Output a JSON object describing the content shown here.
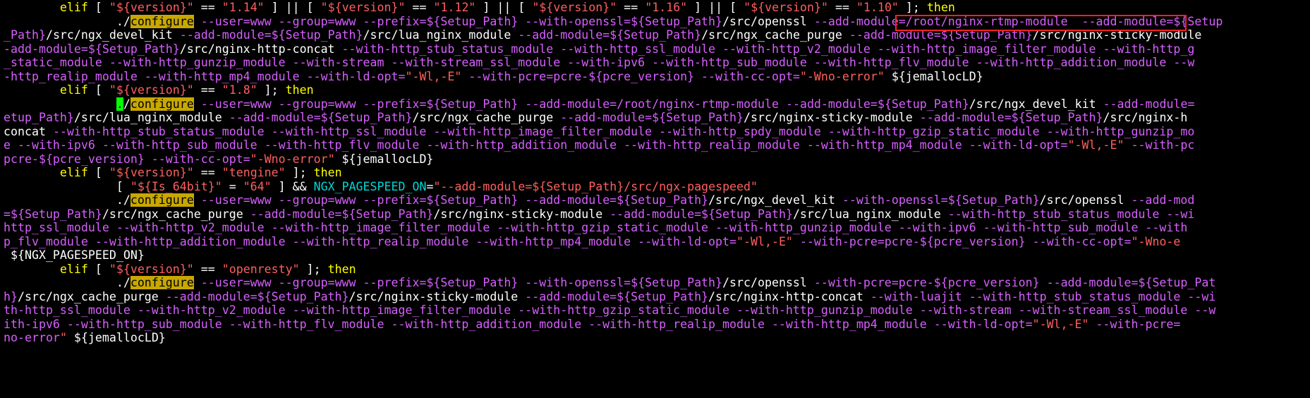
{
  "window": {
    "background": "#000000"
  },
  "colors": {
    "keyword": "#ffff00",
    "string": "#ff5f5f",
    "variable": "#d75fff",
    "text": "#ffffff",
    "shell_var": "#00d7d7",
    "search_highlight_bg": "#c8a800",
    "cursor_bg": "#00ff00",
    "annotation_box": "#ff2020"
  },
  "lines": [
    [
      [
        "kw",
        "        elif"
      ],
      [
        "bw",
        " [ "
      ],
      [
        "str",
        "\"${version}\""
      ],
      [
        "bw",
        " == "
      ],
      [
        "str",
        "\"1.14\""
      ],
      [
        "bw",
        " ] || [ "
      ],
      [
        "str",
        "\"${version}\""
      ],
      [
        "bw",
        " == "
      ],
      [
        "str",
        "\"1.12\""
      ],
      [
        "bw",
        " ] || [ "
      ],
      [
        "str",
        "\"${version}\""
      ],
      [
        "bw",
        " == "
      ],
      [
        "str",
        "\"1.16\""
      ],
      [
        "bw",
        " ] || [ "
      ],
      [
        "str",
        "\"${version}\""
      ],
      [
        "bw",
        " == "
      ],
      [
        "str",
        "\"1.10\""
      ],
      [
        "bw",
        " ]; "
      ],
      [
        "kw",
        "then"
      ]
    ],
    [
      [
        "bw",
        "                ./"
      ],
      [
        "hl",
        "configure"
      ],
      [
        "bw",
        " "
      ],
      [
        "var",
        "--user=www --group=www --prefix=${Setup_Path} --with-openssl=${Setup_Path}"
      ],
      [
        "bw",
        "/src/openssl "
      ],
      [
        "var",
        "--add-module=/root/nginx-rtmp-module"
      ],
      [
        "bw",
        "  "
      ],
      [
        "var",
        "--add-module=${Setup"
      ]
    ],
    [
      [
        "var",
        "_Path}"
      ],
      [
        "bw",
        "/src/ngx_devel_kit "
      ],
      [
        "var",
        "--add-module=${Setup_Path}"
      ],
      [
        "bw",
        "/src/lua_nginx_module "
      ],
      [
        "var",
        "--add-module=${Setup_Path}"
      ],
      [
        "bw",
        "/src/ngx_cache_purge "
      ],
      [
        "var",
        "--add-module=${Setup_Path}"
      ],
      [
        "bw",
        "/src/nginx-sticky-module"
      ]
    ],
    [
      [
        "var",
        "-add-module=${Setup_Path}"
      ],
      [
        "bw",
        "/src/nginx-http-concat "
      ],
      [
        "var",
        "--with-http_stub_status_module --with-http_ssl_module --with-http_v2_module --with-http_image_filter_module --with-http_g"
      ]
    ],
    [
      [
        "var",
        "_static_module --with-http_gunzip_module --with-stream --with-stream_ssl_module --with-ipv6 --with-http_sub_module --with-http_flv_module --with-http_addition_module --w"
      ]
    ],
    [
      [
        "var",
        "-http_realip_module --with-http_mp4_module --with-ld-opt="
      ],
      [
        "str",
        "\"-Wl,-E\""
      ],
      [
        "var",
        " --with-pcre=pcre-${pcre_version} --with-cc-opt="
      ],
      [
        "str",
        "\"-Wno-error\""
      ],
      [
        "bw",
        " ${jemallocLD}"
      ]
    ],
    [
      [
        "kw",
        "        elif"
      ],
      [
        "bw",
        " [ "
      ],
      [
        "str",
        "\"${version}\""
      ],
      [
        "bw",
        " == "
      ],
      [
        "str",
        "\"1.8\""
      ],
      [
        "bw",
        " ]; "
      ],
      [
        "kw",
        "then"
      ]
    ],
    [
      [
        "bw",
        "                "
      ],
      [
        "cursor",
        "."
      ],
      [
        "bw",
        "/"
      ],
      [
        "hl",
        "configure"
      ],
      [
        "bw",
        " "
      ],
      [
        "var",
        "--user=www --group=www --prefix=${Setup_Path} --add-module=/root/nginx-rtmp-module --add-module=${Setup_Path}"
      ],
      [
        "bw",
        "/src/ngx_devel_kit "
      ],
      [
        "var",
        "--add-module="
      ]
    ],
    [
      [
        "var",
        "etup_Path}"
      ],
      [
        "bw",
        "/src/lua_nginx_module "
      ],
      [
        "var",
        "--add-module=${Setup_Path}"
      ],
      [
        "bw",
        "/src/ngx_cache_purge "
      ],
      [
        "var",
        "--add-module=${Setup_Path}"
      ],
      [
        "bw",
        "/src/nginx-sticky-module "
      ],
      [
        "var",
        "--add-module=${Setup_Path}"
      ],
      [
        "bw",
        "/src/nginx-h"
      ]
    ],
    [
      [
        "bw",
        "concat "
      ],
      [
        "var",
        "--with-http_stub_status_module --with-http_ssl_module --with-http_image_filter_module --with-http_spdy_module --with-http_gzip_static_module --with-http_gunzip_mo"
      ]
    ],
    [
      [
        "var",
        "e --with-ipv6 --with-http_sub_module --with-http_flv_module --with-http_addition_module --with-http_realip_module --with-http_mp4_module --with-ld-opt="
      ],
      [
        "str",
        "\"-Wl,-E\""
      ],
      [
        "var",
        " --with-pc"
      ]
    ],
    [
      [
        "var",
        "pcre-${pcre_version} --with-cc-opt="
      ],
      [
        "str",
        "\"-Wno-error\""
      ],
      [
        "bw",
        " ${jemallocLD}"
      ]
    ],
    [
      [
        "kw",
        "        elif"
      ],
      [
        "bw",
        " [ "
      ],
      [
        "str",
        "\"${version}\""
      ],
      [
        "bw",
        " == "
      ],
      [
        "str",
        "\"tengine\""
      ],
      [
        "bw",
        " ]; "
      ],
      [
        "kw",
        "then"
      ]
    ],
    [
      [
        "bw",
        "                [ "
      ],
      [
        "str",
        "\"${Is_64bit}\""
      ],
      [
        "bw",
        " = "
      ],
      [
        "str",
        "\"64\""
      ],
      [
        "bw",
        " ] && "
      ],
      [
        "cy",
        "NGX_PAGESPEED_ON"
      ],
      [
        "bw",
        "="
      ],
      [
        "str",
        "\"--add-module=${Setup_Path}/src/ngx-pagespeed\""
      ]
    ],
    [
      [
        "bw",
        "                ./"
      ],
      [
        "hl",
        "configure"
      ],
      [
        "bw",
        " "
      ],
      [
        "var",
        "--user=www --group=www --prefix=${Setup_Path} --add-module=${Setup_Path}"
      ],
      [
        "bw",
        "/src/ngx_devel_kit "
      ],
      [
        "var",
        "--with-openssl=${Setup_Path}"
      ],
      [
        "bw",
        "/src/openssl "
      ],
      [
        "var",
        "--add-mod"
      ]
    ],
    [
      [
        "var",
        "=${Setup_Path}"
      ],
      [
        "bw",
        "/src/ngx_cache_purge "
      ],
      [
        "var",
        "--add-module=${Setup_Path}"
      ],
      [
        "bw",
        "/src/nginx-sticky-module "
      ],
      [
        "var",
        "--add-module=${Setup_Path}"
      ],
      [
        "bw",
        "/src/lua_nginx_module "
      ],
      [
        "var",
        "--with-http_stub_status_module --wi"
      ]
    ],
    [
      [
        "var",
        "http_ssl_module --with-http_v2_module --with-http_image_filter_module --with-http_gzip_static_module --with-http_gunzip_module --with-ipv6 --with-http_sub_module --with"
      ]
    ],
    [
      [
        "var",
        "p_flv_module --with-http_addition_module --with-http_realip_module --with-http_mp4_module --with-ld-opt="
      ],
      [
        "str",
        "\"-Wl,-E\""
      ],
      [
        "var",
        " --with-pcre=pcre-${pcre_version} --with-cc-opt="
      ],
      [
        "str",
        "\"-Wno-e"
      ]
    ],
    [
      [
        "bw",
        " ${NGX_PAGESPEED_ON}"
      ]
    ],
    [
      [
        "kw",
        "        elif"
      ],
      [
        "bw",
        " [ "
      ],
      [
        "str",
        "\"${version}\""
      ],
      [
        "bw",
        " == "
      ],
      [
        "str",
        "\"openresty\""
      ],
      [
        "bw",
        " ]; "
      ],
      [
        "kw",
        "then"
      ]
    ],
    [
      [
        "bw",
        "                ./"
      ],
      [
        "hl",
        "configure"
      ],
      [
        "bw",
        " "
      ],
      [
        "var",
        "--user=www --group=www --prefix=${Setup_Path} --with-openssl=${Setup_Path}"
      ],
      [
        "bw",
        "/src/openssl "
      ],
      [
        "var",
        "--with-pcre=pcre-${pcre_version} --add-module=${Setup_Pat"
      ]
    ],
    [
      [
        "var",
        "h}"
      ],
      [
        "bw",
        "/src/ngx_cache_purge "
      ],
      [
        "var",
        "--add-module=${Setup_Path}"
      ],
      [
        "bw",
        "/src/nginx-sticky-module "
      ],
      [
        "var",
        "--add-module=${Setup_Path}"
      ],
      [
        "bw",
        "/src/nginx-http-concat "
      ],
      [
        "var",
        "--with-luajit --with-http_stub_status_module --wi"
      ]
    ],
    [
      [
        "var",
        "th-http_ssl_module --with-http_v2_module --with-http_image_filter_module --with-http_gzip_static_module --with-http_gunzip_module --with-stream --with-stream_ssl_module --w"
      ]
    ],
    [
      [
        "var",
        "ith-ipv6 --with-http_sub_module --with-http_flv_module --with-http_addition_module --with-http_realip_module --with-http_mp4_module --with-ld-opt="
      ],
      [
        "str",
        "\"-Wl,-E\""
      ],
      [
        "var",
        " --with-pcre="
      ]
    ],
    [
      [
        "var",
        "no-error"
      ],
      [
        "str",
        "\""
      ],
      [
        "bw",
        " ${jemallocLD}"
      ]
    ]
  ]
}
